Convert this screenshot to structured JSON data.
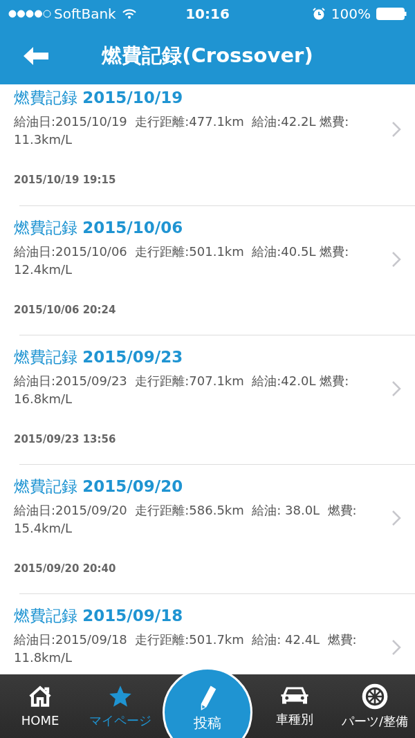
{
  "status_bar": {
    "carrier": "SoftBank",
    "time": "10:16",
    "battery": "100%"
  },
  "nav": {
    "title": "燃費記録(Crossover)"
  },
  "records": [
    {
      "title": "燃費記録 **2015/10/19**",
      "detail": "給油日:2015/10/19  走行距離:477.1km  給油:42.2L 燃費: 11.3km/L",
      "posted": "2015/10/19 19:15"
    },
    {
      "title": "燃費記録 **2015/10/06**",
      "detail": "給油日:2015/10/06  走行距離:501.1km  給油:40.5L 燃費: 12.4km/L",
      "posted": "2015/10/06 20:24"
    },
    {
      "title": "燃費記録 **2015/09/23**",
      "detail": "給油日:2015/09/23  走行距離:707.1km  給油:42.0L 燃費: 16.8km/L",
      "posted": "2015/09/23 13:56"
    },
    {
      "title": "燃費記録 **2015/09/20**",
      "detail": "給油日:2015/09/20  走行距離:586.5km  給油: 38.0L  燃費: 15.4km/L",
      "posted": "2015/09/20 20:40"
    },
    {
      "title": "燃費記録 **2015/09/18**",
      "detail": "給油日:2015/09/18  走行距離:501.7km  給油: 42.4L  燃費: 11.8km/L"
    }
  ],
  "tab_bar": [
    {
      "kind": "home",
      "label": "HOME",
      "selected": false
    },
    {
      "kind": "star",
      "label": "マイページ",
      "selected": true
    },
    {
      "kind": "post",
      "label": "投稿",
      "selected": false
    },
    {
      "kind": "car",
      "label": "車種別",
      "selected": false
    },
    {
      "kind": "wheel",
      "label": "パーツ/整備",
      "selected": false
    }
  ]
}
